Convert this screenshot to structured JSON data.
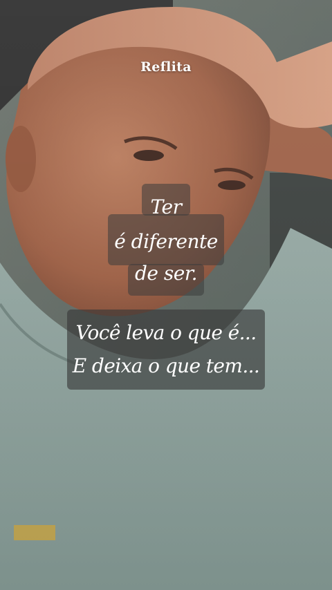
{
  "header": {
    "title": "Reflita"
  },
  "quote_primary": {
    "lines": [
      "Ter",
      "é diferente",
      "de ser."
    ]
  },
  "quote_secondary": {
    "lines": [
      "Você leva o que é...",
      "E deixa o que tem..."
    ]
  },
  "colors": {
    "shirt": "#8a9d98",
    "skin": "#a8694d",
    "cap": "#c98a6d",
    "text": "#ffffff",
    "overlay": "rgba(55,55,55,0.6)"
  }
}
